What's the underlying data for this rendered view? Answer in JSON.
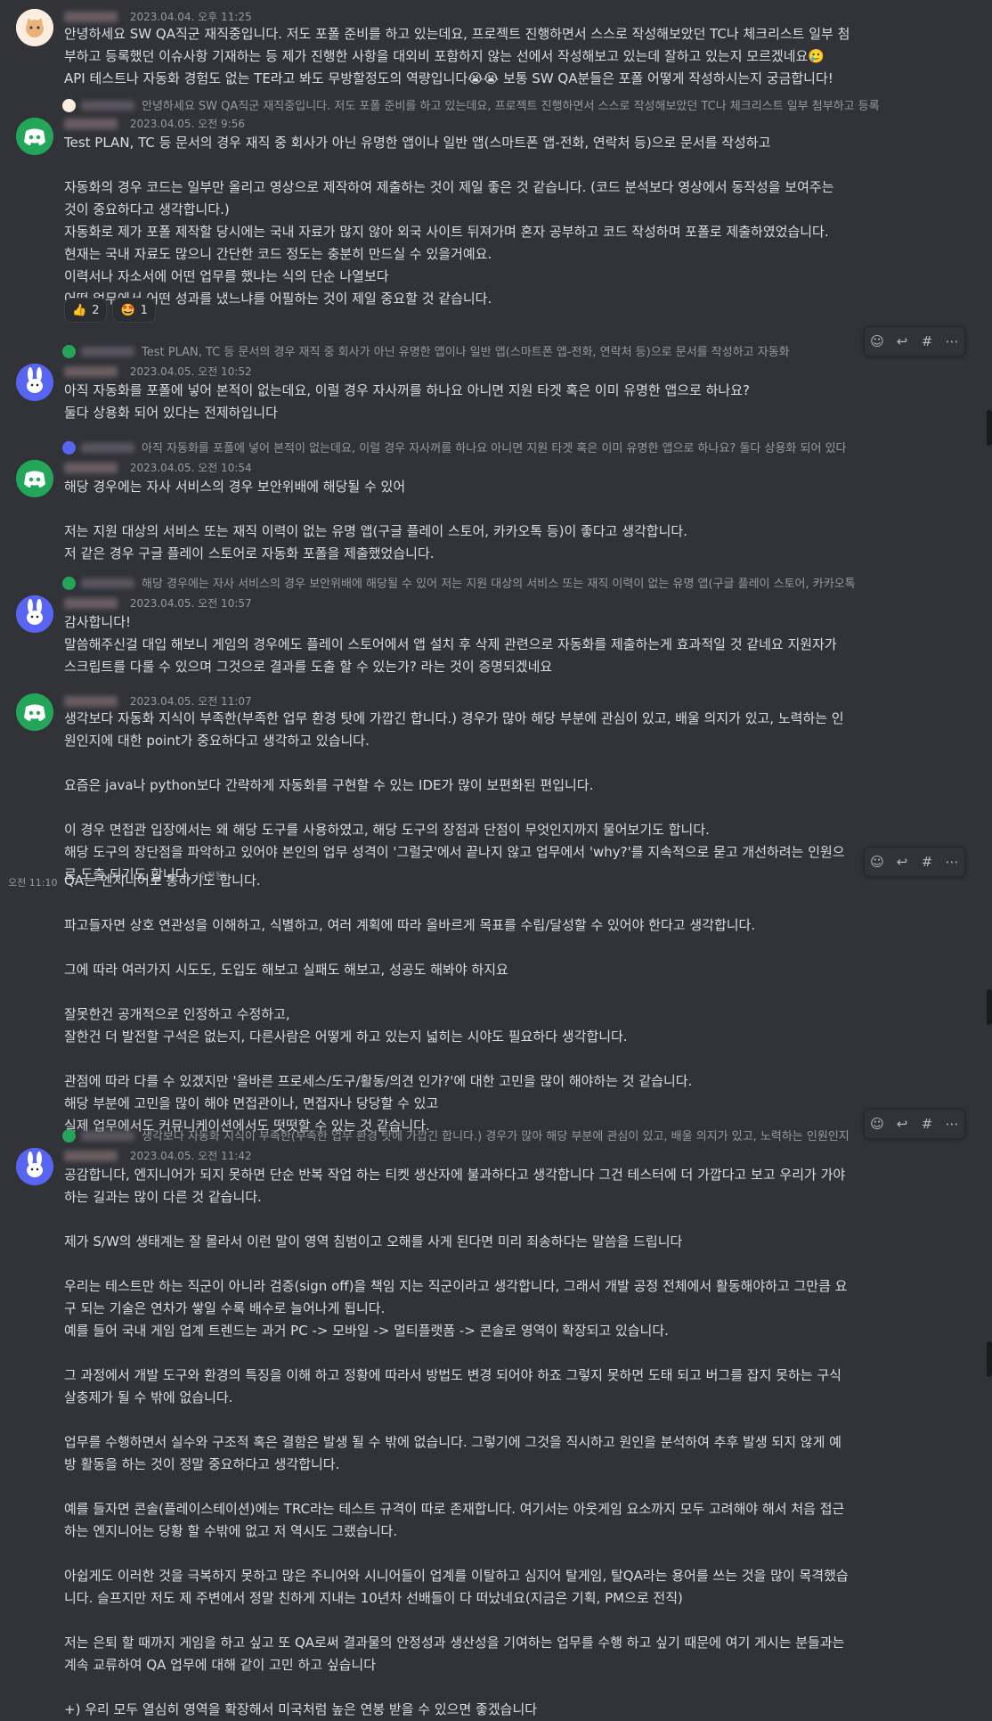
{
  "messages": [
    {
      "id": "m1",
      "timestamp": "2023.04.04. 오후 11:25",
      "lines": [
        "안녕하세요 SW QA직군 재직중입니다. 저도 포폴 준비를 하고 있는데요, 프로젝트 진행하면서 스스로 작성해보았던 TC나 체크리스트 일부 첨",
        "부하고 등록했던 이슈사항 기재하는 등 제가 진행한 사항을 대외비 포함하지 않는 선에서 작성해보고 있는데 잘하고 있는지 모르겠네요🥲",
        "API 테스트나 자동화 경험도 없는 TE라고 봐도 무방할정도의 역량입니다😭😭 보통 SW QA분들은 포폴 어떻게 작성하시는지 궁금합니다!"
      ]
    },
    {
      "id": "m2",
      "reply_text": "안녕하세요 SW QA직군 재직중입니다. 저도 포폴 준비를 하고 있는데요, 프로젝트 진행하면서 스스로 작성해보았던 TC나 체크리스트 일부 첨부하고 등록",
      "timestamp": "2023.04.05. 오전 9:56",
      "lines": [
        "Test PLAN, TC 등 문서의 경우 재직 중 회사가 아닌 유명한 앱이나 일반 앱(스마트폰 앱-전화, 연락처 등)으로 문서를 작성하고",
        "",
        "자동화의 경우 코드는 일부만 올리고 영상으로 제작하여 제출하는 것이 제일 좋은 것 같습니다. (코드 분석보다 영상에서 동작성을 보여주는",
        "것이 중요하다고 생각합니다.)",
        "자동화로 제가 포폴 제작할 당시에는 국내 자료가 많지 않아 외국 사이트 뒤져가며 혼자 공부하고 코드 작성하며 포폴로 제출하였었습니다.",
        "현재는 국내 자료도 많으니 간단한 코드 정도는 충분히 만드실 수 있을거예요.",
        "이력서나 자소서에 어떤 업무를 했냐는 식의 단순 나열보다",
        "어떤 업무에서 어떤 성과를 냈느냐를 어필하는 것이 제일 중요할 것 같습니다."
      ],
      "reactions": [
        {
          "emoji": "👍",
          "count": "2"
        },
        {
          "emoji": "🤩",
          "count": "1"
        }
      ]
    },
    {
      "id": "m3",
      "reply_text": "Test PLAN, TC 등 문서의 경우 재직 중 회사가 아닌 유명한 앱이나 일반 앱(스마트폰 앱-전화, 연락처 등)으로 문서를 작성하고 자동화",
      "timestamp": "2023.04.05. 오전 10:52",
      "lines": [
        "아직 자동화를 포폴에 넣어 본적이 없는데요, 이럴 경우 자사꺼를 하나요 아니면 지원 타겟 혹은 이미 유명한 앱으로 하나요?",
        "둘다 상용화 되어 있다는 전제하입니다"
      ]
    },
    {
      "id": "m4",
      "reply_text": "아직 자동화를 포폴에 넣어 본적이 없는데요, 이럴 경우 자사꺼를 하나요 아니면 지원 타겟 혹은 이미 유명한 앱으로 하나요? 둘다 상용화 되어 있다",
      "timestamp": "2023.04.05. 오전 10:54",
      "lines": [
        "해당 경우에는 자사 서비스의 경우 보안위배에 해당될 수 있어",
        "",
        "저는 지원 대상의 서비스 또는 재직 이력이 없는 유명 앱(구글 플레이 스토어, 카카오톡 등)이 좋다고 생각합니다.",
        "저 같은 경우 구글 플레이 스토어로 자동화 포폴을 제출했었습니다."
      ]
    },
    {
      "id": "m5",
      "reply_text": "해당 경우에는 자사 서비스의 경우 보안위배에 해당될 수 있어 저는 지원 대상의 서비스 또는 재직 이력이 없는 유명 앱(구글 플레이 스토어, 카카오톡",
      "timestamp": "2023.04.05. 오전 10:57",
      "lines": [
        "감사합니다!",
        "말씀해주신걸 대입 해보니 게임의 경우에도 플레이 스토어에서 앱 설치 후 삭제 관련으로 자동화를 제출하는게 효과적일 것 같네요 지원자가",
        "스크립트를 다룰 수 있으며 그것으로 결과를 도출 할 수 있는가? 라는 것이 증명되겠네요"
      ]
    },
    {
      "id": "m6",
      "timestamp": "2023.04.05. 오전 11:07",
      "lines": [
        "생각보다 자동화 지식이 부족한(부족한 업무 환경 탓에 가깝긴 합니다.) 경우가 많아 해당 부분에 관심이 있고, 배울 의지가 있고, 노력하는 인",
        "원인지에 대한 point가 중요하다고 생각하고 있습니다.",
        "",
        "요즘은 java나 python보다 간략하게 자동화를 구현할 수 있는 IDE가 많이 보편화된 편입니다.",
        "",
        "이 경우 면접관 입장에서는 왜 해당 도구를 사용하였고, 해당 도구의 장점과 단점이 무엇인지까지 물어보기도 합니다.",
        "해당 도구의 장단점을 파악하고 있어야 본인의 업무 성격이 '그럴굿'에서 끝나지 않고 업무에서 'why?'를 지속적으로 묻고 개선하려는 인원으",
        "로 도출 되기도 합니다."
      ],
      "edited_label": "(수정됨)"
    },
    {
      "id": "m7",
      "gutter_time": "오전 11:10",
      "lines": [
        "QA는 엔지니어로 통하기도 합니다.",
        "",
        "파고들자면 상호 연관성을 이해하고, 식별하고, 여러 계획에 따라 올바르게 목표를 수립/달성할 수 있어야 한다고 생각합니다.",
        "",
        "그에 따라 여러가지 시도도, 도입도 해보고 실패도 해보고, 성공도 해봐야 하지요",
        "",
        "잘못한건 공개적으로 인정하고 수정하고,",
        "잘한건 더 발전할 구석은 없는지, 다른사람은 어떻게 하고 있는지 넓히는 시야도 필요하다 생각합니다.",
        "",
        "관점에 따라 다를 수 있겠지만 '올바른 프로세스/도구/활동/의견 인가?'에 대한 고민을 많이 해야하는 것 같습니다.",
        "해당 부분에 고민을 많이 해야 면접관이나, 면접자나 당당할 수 있고",
        "실제 업무에서도 커뮤니케이션에서도 떳떳할 수 있는 것 같습니다."
      ]
    },
    {
      "id": "m8",
      "reply_text": "생각보다 자동화 지식이 부족한(부족한 업무 환경 탓에 가깝긴 합니다.) 경우가 많아 해당 부분에 관심이 있고, 배울 의지가 있고, 노력하는 인원인지",
      "timestamp": "2023.04.05. 오전 11:42",
      "lines": [
        "공감합니다, 엔지니어가 되지 못하면 단순 반복 작업 하는 티켓 생산자에 불과하다고 생각합니다 그건 테스터에 더 가깝다고 보고 우리가 가야",
        "하는 길과는 많이 다른 것 같습니다.",
        "",
        "제가 S/W의 생태계는 잘 몰라서 이런 말이 영역 침범이고 오해를 사게 된다면 미리 죄송하다는 말씀을 드립니다",
        "",
        "우리는 테스트만 하는 직군이 아니라 검증(sign off)을 책임 지는 직군이라고 생각합니다, 그래서 개발 공정 전체에서 활동해야하고 그만큼 요",
        "구 되는 기술은 연차가 쌓일 수록 배수로 늘어나게 됩니다.",
        "예를 들어 국내 게임 업계 트렌드는 과거 PC -> 모바일 -> 멀티플랫폼 -> 콘솔로 영역이 확장되고 있습니다.",
        "",
        "그 과정에서 개발 도구와 환경의 특징을 이해 하고 정황에 따라서 방법도 변경 되어야 하죠 그렇지 못하면 도태 되고 버그를 잡지 못하는 구식",
        "살충제가 될 수 밖에 없습니다.",
        "",
        "업무를 수행하면서 실수와 구조적 혹은 결함은 발생 될 수 밖에 없습니다. 그렇기에 그것을 직시하고 원인을 분석하여 추후 발생 되지 않게 예",
        "방 활동을 하는 것이 정말 중요하다고 생각합니다.",
        "",
        "예를 들자면 콘솔(플레이스테이션)에는 TRC라는 테스트 규격이 따로 존재합니다. 여기서는 아웃게임 요소까지 모두 고려해야 해서 처음 접근",
        "하는 엔지니어는 당황 할 수밖에 없고 저 역시도 그랬습니다.",
        "",
        "아쉽게도 이러한 것을 극복하지 못하고 많은 주니어와 시니어들이 업계를 이탈하고 심지어 탈게임, 탈QA라는 용어를 쓰는 것을 많이 목격했습",
        "니다. 슬프지만 저도 제 주변에서 정말 친하게 지내는 10년차 선배들이 다 떠났네요(지금은 기획, PM으로 전직)",
        "",
        "저는 은퇴 할 때까지 게임을 하고 싶고 또 QA로써 결과물의 안정성과 생산성을 기여하는 업무를 수행 하고 싶기 때문에  여기 게시는 분들과는",
        "계속 교류하여 QA 업무에 대해 같이 고민 하고 싶습니다",
        "",
        "+) 우리 모두 열심히 영역을 확장해서 미국처럼 높은 연봉 받을 수 있으면 좋겠습니다"
      ]
    }
  ],
  "toolbar": {
    "icons": [
      "add-reaction-icon",
      "reply-icon",
      "create-thread-icon",
      "more-icon"
    ]
  },
  "colors": {
    "background": "#313338",
    "text": "#dbdee1",
    "muted": "#949ba4",
    "discord_green": "#23a55a",
    "blurple": "#5865f2"
  }
}
